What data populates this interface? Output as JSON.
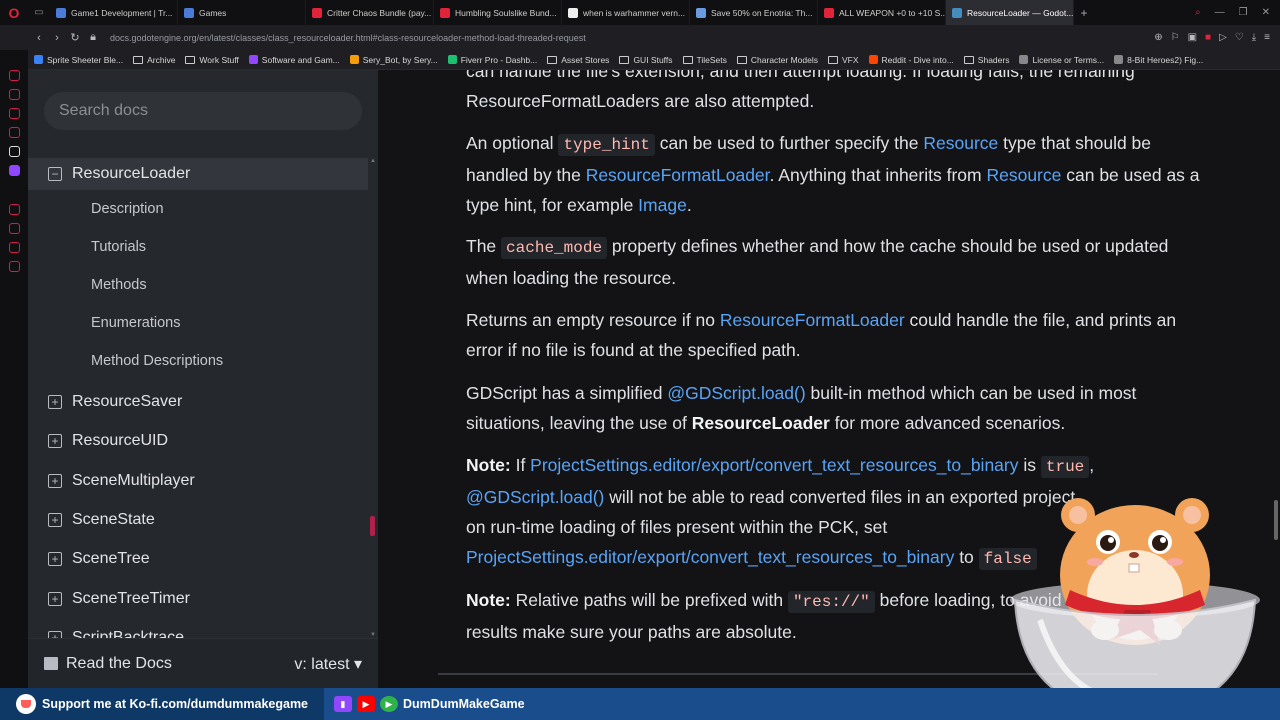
{
  "browser": {
    "tabs": [
      {
        "label": "Game1 Development | Tr...",
        "color": "#4a7bd8",
        "active": false
      },
      {
        "label": "Games",
        "color": "#4a7bd8",
        "active": false
      },
      {
        "label": "Critter Chaos Bundle (pay...",
        "color": "#e0243a",
        "active": false
      },
      {
        "label": "Humbling Soulslike Bund...",
        "color": "#e0243a",
        "active": false
      },
      {
        "label": "when is warhammer vern...",
        "color": "#eeeeee",
        "active": false
      },
      {
        "label": "Save 50% on Enotria: Th...",
        "color": "#6a9be0",
        "active": false
      },
      {
        "label": "ALL WEAPON +0 to +10 S...",
        "color": "#e0243a",
        "active": false
      },
      {
        "label": "ResourceLoader — Godot...",
        "color": "#478cbf",
        "active": true
      }
    ],
    "url": "docs.godotengine.org/en/latest/classes/class_resourceloader.html#class-resourceloader-method-load-threaded-request",
    "bookmarks": [
      {
        "label": "Sprite Sheeter Ble...",
        "kind": "icon",
        "color": "#3b82f6"
      },
      {
        "label": "Archive",
        "kind": "folder"
      },
      {
        "label": "Work Stuff",
        "kind": "folder"
      },
      {
        "label": "Software and Gam...",
        "kind": "icon",
        "color": "#9147ff"
      },
      {
        "label": "Sery_Bot, by Sery...",
        "kind": "icon",
        "color": "#f59e0b"
      },
      {
        "label": "Fiverr Pro - Dashb...",
        "kind": "icon",
        "color": "#1dbf73"
      },
      {
        "label": "Asset Stores",
        "kind": "folder"
      },
      {
        "label": "GUI Stuffs",
        "kind": "folder"
      },
      {
        "label": "TileSets",
        "kind": "folder"
      },
      {
        "label": "Character Models",
        "kind": "folder"
      },
      {
        "label": "VFX",
        "kind": "folder"
      },
      {
        "label": "Reddit - Dive into...",
        "kind": "icon",
        "color": "#ff4500"
      },
      {
        "label": "Shaders",
        "kind": "folder"
      },
      {
        "label": "License or Terms...",
        "kind": "icon",
        "color": "#888888"
      },
      {
        "label": "8-Bit Heroes2) Fig...",
        "kind": "icon",
        "color": "#888888"
      }
    ]
  },
  "sidebar": {
    "search_placeholder": "Search docs",
    "current": {
      "label": "ResourceLoader",
      "toggle": "−"
    },
    "sub_items": [
      "Description",
      "Tutorials",
      "Methods",
      "Enumerations",
      "Method Descriptions"
    ],
    "items": [
      {
        "label": "ResourceSaver",
        "toggle": "+"
      },
      {
        "label": "ResourceUID",
        "toggle": "+"
      },
      {
        "label": "SceneMultiplayer",
        "toggle": "+"
      },
      {
        "label": "SceneState",
        "toggle": "+"
      },
      {
        "label": "SceneTree",
        "toggle": "+"
      },
      {
        "label": "SceneTreeTimer",
        "toggle": "+"
      },
      {
        "label": "ScriptBacktrace",
        "toggle": "+"
      }
    ],
    "footer": {
      "label": "Read the Docs",
      "version": "v: latest ▾"
    }
  },
  "content": {
    "p0": {
      "t1": "can handle the file's extension, and then attempt loading. If loading fails, the remaining",
      "t2": "ResourceFormatLoaders are also attempted."
    },
    "p1": {
      "a": "An optional ",
      "code": "type_hint",
      "b": " can be used to further specify the ",
      "link1": "Resource",
      "c": " type that should be handled by the ",
      "link2": "ResourceFormatLoader",
      "d": ". Anything that inherits from ",
      "link3": "Resource",
      "e": " can be used as a type hint, for example ",
      "link4": "Image",
      "f": "."
    },
    "p2": {
      "a": "The ",
      "code": "cache_mode",
      "b": " property defines whether and how the cache should be used or updated when loading the resource."
    },
    "p3": {
      "a": "Returns an empty resource if no ",
      "link": "ResourceFormatLoader",
      "b": " could handle the file, and prints an error if no file is found at the specified path."
    },
    "p4": {
      "a": "GDScript has a simplified ",
      "link": "@GDScript.load()",
      "b": " built-in method which can be used in most situations, leaving the use of ",
      "bold": "ResourceLoader",
      "c": " for more advanced scenarios."
    },
    "p5": {
      "note": "Note:",
      "a": " If ",
      "link1": "ProjectSettings.editor/export/convert_text_resources_to_binary",
      "b": " is ",
      "code1": "true",
      "c": ",",
      "link2": "@GDScript.load()",
      "d": " will not be able to read converted files in an exported project",
      "e": "on run-time loading of files present within the PCK, set",
      "link3": "ProjectSettings.editor/export/convert_text_resources_to_binary",
      "f": " to ",
      "code2": "false"
    },
    "p6": {
      "note": "Note:",
      "a": " Relative paths will be prefixed with ",
      "code": "\"res://\"",
      "b": " before loading, to avoid unexpected",
      "c": "results make sure your paths are absolute."
    }
  },
  "stream": {
    "kofi": "Support me at Ko-fi.com/dumdummakegame",
    "handle": "DumDumMakeGame"
  }
}
